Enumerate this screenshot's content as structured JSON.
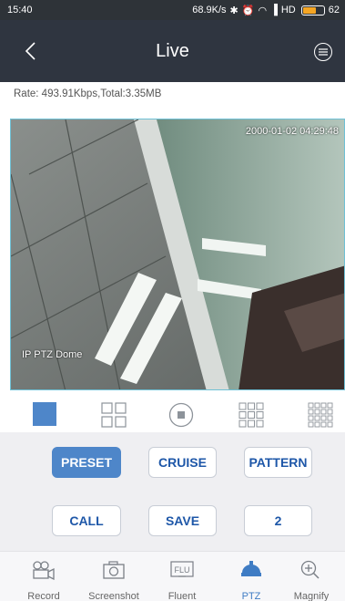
{
  "status_bar": {
    "time": "15:40",
    "speed": "68.9K/s",
    "network": "HD",
    "battery_percent": "62",
    "battery_level": 0.62
  },
  "header": {
    "title": "Live"
  },
  "stream_info": {
    "rate_text": "Rate: 493.91Kbps,Total:3.35MB"
  },
  "video": {
    "timestamp": "2000-01-02 04:29:48",
    "camera_label": "IP PTZ Dome"
  },
  "layout_options": [
    {
      "name": "single",
      "active": true
    },
    {
      "name": "quad",
      "active": false
    },
    {
      "name": "record",
      "active": false
    },
    {
      "name": "nine",
      "active": false
    },
    {
      "name": "sixteen",
      "active": false
    }
  ],
  "ptz": {
    "preset_label": "PRESET",
    "cruise_label": "CRUISE",
    "pattern_label": "PATTERN",
    "call_label": "CALL",
    "save_label": "SAVE",
    "preset_number": "2",
    "active_mode": "PRESET"
  },
  "tabs": [
    {
      "label": "Record",
      "icon": "video-camera-icon"
    },
    {
      "label": "Screenshot",
      "icon": "camera-icon"
    },
    {
      "label": "Fluent",
      "icon": "flu-icon",
      "icon_text": "FLU"
    },
    {
      "label": "PTZ",
      "icon": "ptz-dome-icon",
      "active": true
    },
    {
      "label": "Magnify",
      "icon": "zoom-in-icon"
    }
  ],
  "colors": {
    "header_bg": "#2f3540",
    "accent": "#4e86c9",
    "button_text": "#1e57a8",
    "panel_bg": "#efeff2"
  }
}
